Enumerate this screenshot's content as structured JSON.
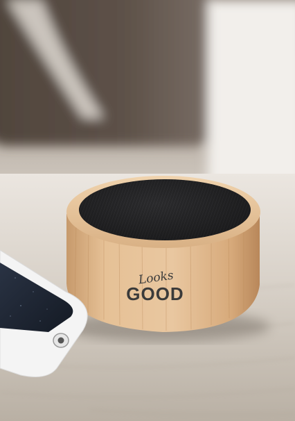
{
  "photo": {
    "product": "wooden-bluetooth-speaker",
    "props": [
      "smartphone-with-white-case",
      "wooden-table",
      "blurred-background-cushion"
    ],
    "printed_logo": {
      "script_word": "Looks",
      "block_word": "GOOD",
      "ink_color": "#3a3a3a"
    },
    "colors": {
      "bamboo_light": "#e2b98a",
      "bamboo_dark": "#b8875a",
      "speaker_mesh": "#2a2a2c",
      "table": "#c9c2b7",
      "background_dark": "#5a4e46",
      "phone_case": "#f4f4f4",
      "phone_screen": "#1d2430"
    }
  }
}
